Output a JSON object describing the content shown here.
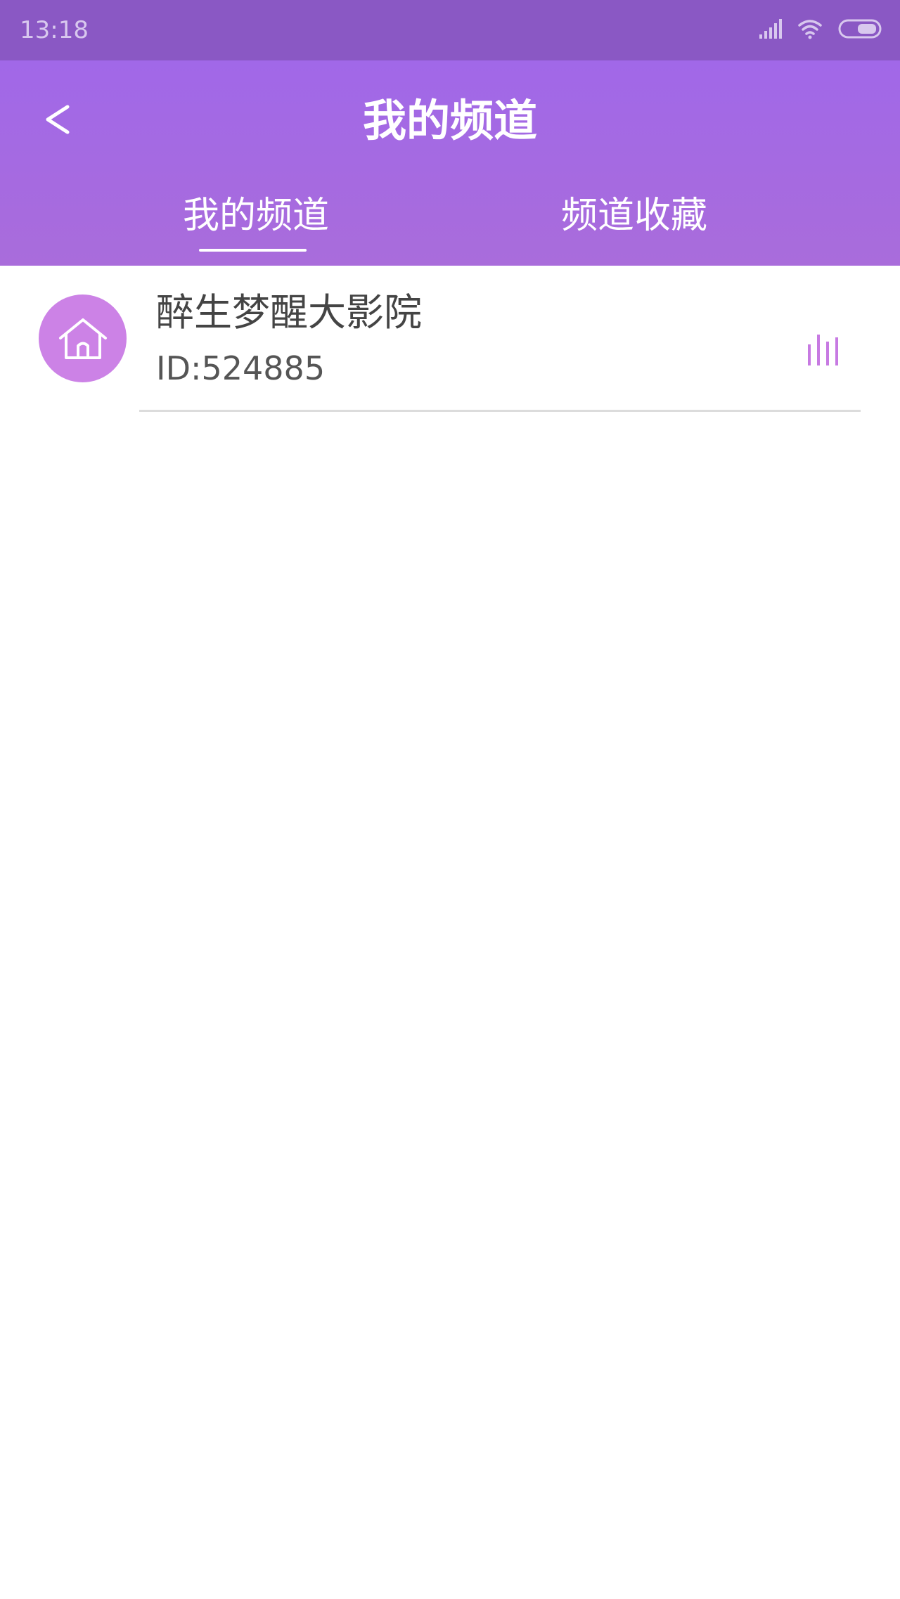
{
  "status_bar": {
    "time": "13:18",
    "icons": [
      "signal-icon",
      "wifi-icon",
      "battery-icon"
    ],
    "background": "#8a58c4"
  },
  "header": {
    "back_label": "<",
    "title": "我的频道",
    "background": "#a168e8",
    "tabs": [
      {
        "label": "我的频道",
        "active": true
      },
      {
        "label": "频道收藏",
        "active": false
      }
    ]
  },
  "channels": [
    {
      "name": "醉生梦醒大影院",
      "id_text": "ID:524885",
      "icon": "home-icon",
      "status_icon": "playing-bars-icon",
      "avatar_color": "#cc82e6"
    }
  ]
}
